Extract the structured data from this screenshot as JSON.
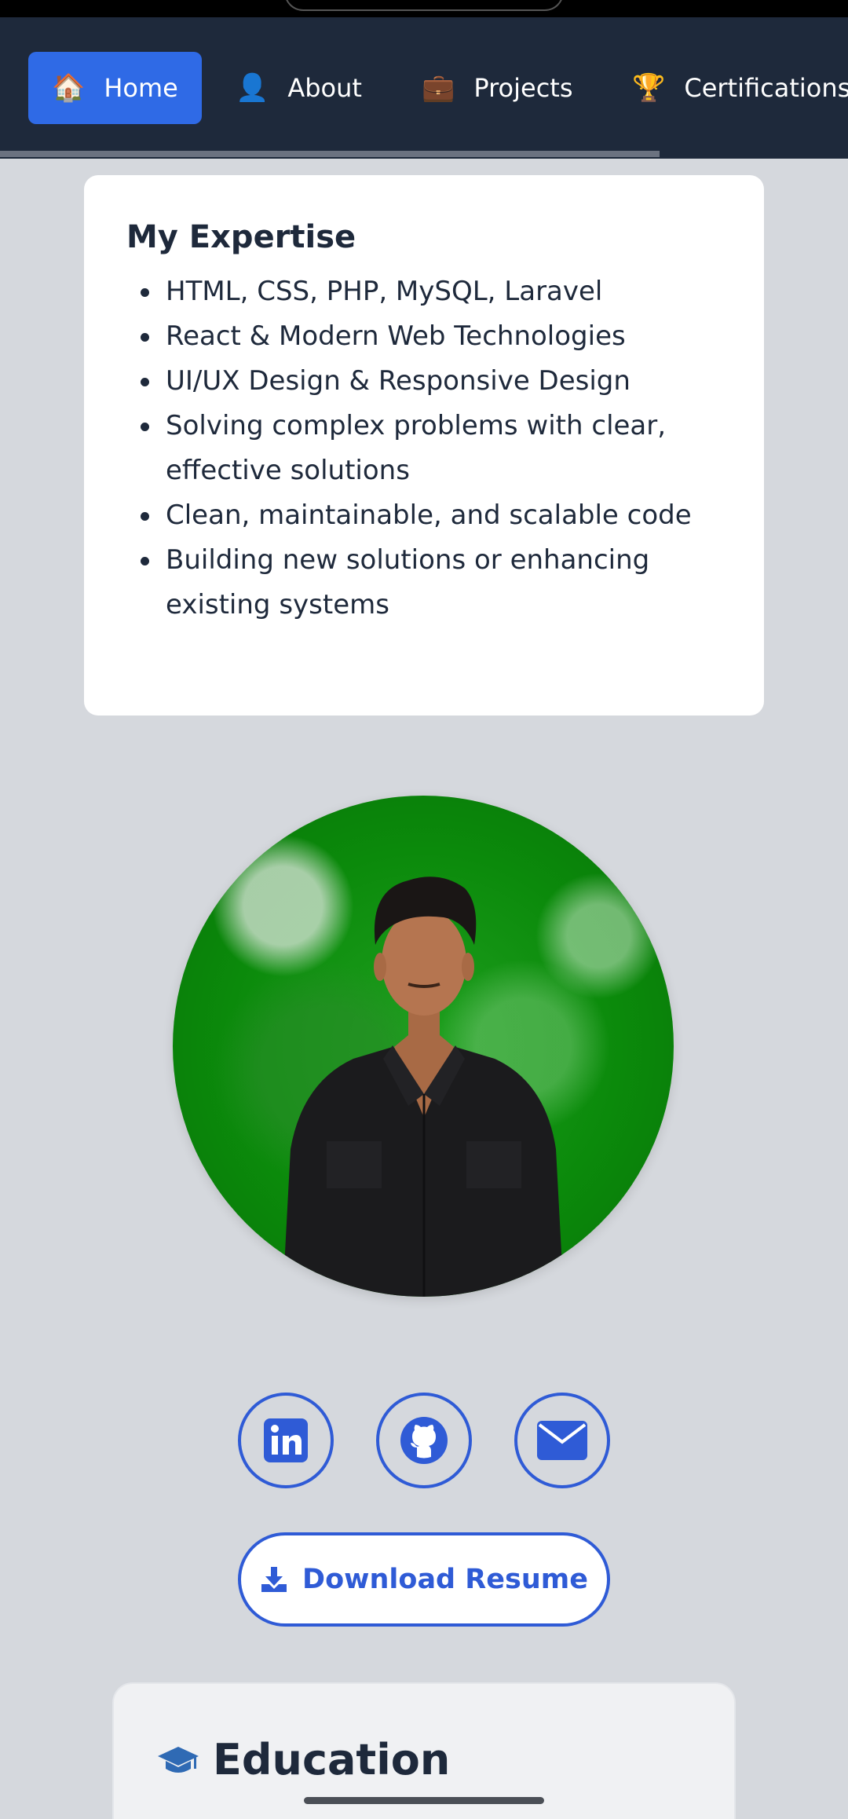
{
  "nav": {
    "items": [
      {
        "icon": "🏠",
        "label": "Home",
        "active": true
      },
      {
        "icon": "👤",
        "label": "About"
      },
      {
        "icon": "💼",
        "label": "Projects"
      },
      {
        "icon": "🏆",
        "label": "Certifications"
      }
    ]
  },
  "expertise": {
    "title": "My Expertise",
    "items": [
      "HTML, CSS, PHP, MySQL, Laravel",
      "React & Modern Web Technologies",
      "UI/UX Design & Responsive Design",
      "Solving complex problems with clear, effective solutions",
      "Clean, maintainable, and scalable code",
      "Building new solutions or enhancing existing systems"
    ]
  },
  "social": {
    "icons": [
      "linkedin-icon",
      "github-icon",
      "email-icon"
    ]
  },
  "resume": {
    "label": "Download Resume"
  },
  "education": {
    "title": "Education"
  },
  "colors": {
    "nav_bg": "#1e293b",
    "accent": "#2f6ae6",
    "link": "#2f5bd6",
    "page_bg": "#d5d8dd"
  }
}
